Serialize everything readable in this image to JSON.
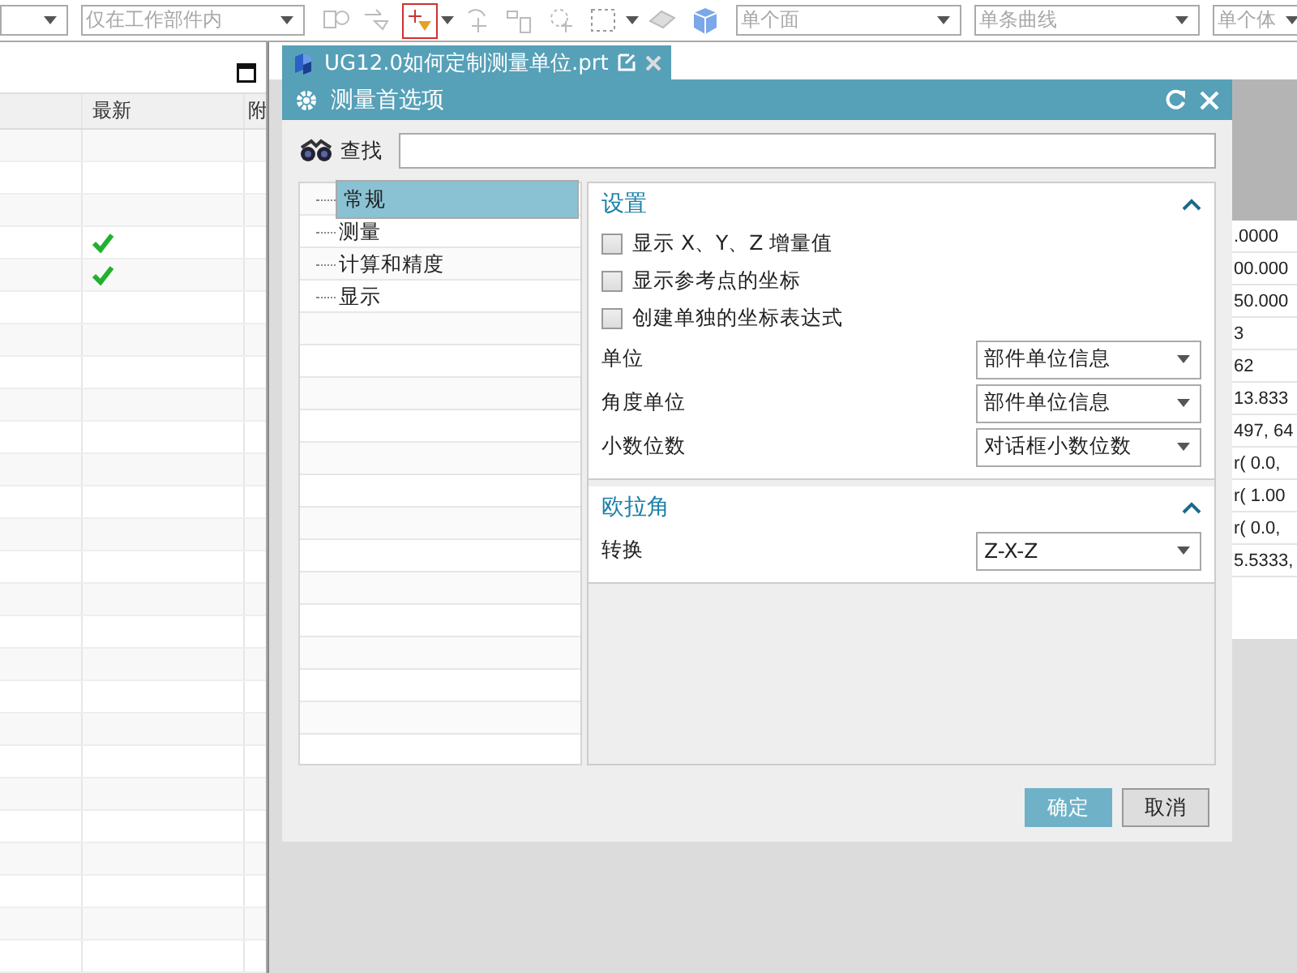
{
  "toolbar": {
    "filters": [
      {
        "value": "仅在工作部件内",
        "disabled": true
      },
      {
        "value": "单个面",
        "disabled": true
      },
      {
        "value": "单条曲线",
        "disabled": true
      },
      {
        "value": "单个体",
        "disabled": true
      }
    ],
    "tools": [
      {
        "selected": false,
        "dropdown": false
      },
      {
        "selected": false,
        "dropdown": false
      },
      {
        "selected": true,
        "dropdown": true
      },
      {
        "selected": false,
        "dropdown": false
      },
      {
        "selected": false,
        "dropdown": false
      },
      {
        "selected": false,
        "dropdown": false
      },
      {
        "selected": false,
        "dropdown": true
      },
      {
        "selected": false,
        "dropdown": false
      },
      {
        "selected": false,
        "dropdown": false
      }
    ]
  },
  "navigator": {
    "columns": [
      "最新",
      "附"
    ],
    "rows": [
      {
        "latest": false
      },
      {
        "latest": false
      },
      {
        "latest": false
      },
      {
        "latest": true
      },
      {
        "latest": true
      },
      {
        "latest": false
      },
      {
        "latest": false
      },
      {
        "latest": false
      },
      {
        "latest": false
      },
      {
        "latest": false
      },
      {
        "latest": false
      },
      {
        "latest": false
      },
      {
        "latest": false
      },
      {
        "latest": false
      },
      {
        "latest": false
      },
      {
        "latest": false
      },
      {
        "latest": false
      },
      {
        "latest": false
      },
      {
        "latest": false
      },
      {
        "latest": false
      },
      {
        "latest": false
      },
      {
        "latest": false
      },
      {
        "latest": false
      },
      {
        "latest": false
      },
      {
        "latest": false
      },
      {
        "latest": false
      }
    ]
  },
  "tab": {
    "title": "UG12.0如何定制测量单位.prt",
    "selected": true
  },
  "results": [
    ".0000",
    "00.000",
    "50.000",
    "3",
    "62",
    "13.833",
    "497, 64",
    "r( 0.0,",
    "r( 1.00",
    "r( 0.0,",
    "5.5333,"
  ],
  "dialog": {
    "title": "测量首选项",
    "search": {
      "label": "查找"
    },
    "tree": [
      {
        "label": "常规",
        "selected": true
      },
      {
        "label": "测量",
        "selected": false
      },
      {
        "label": "计算和精度",
        "selected": false
      },
      {
        "label": "显示",
        "selected": false
      }
    ],
    "groups": [
      {
        "title": "设置",
        "expanded": true,
        "checkboxes": [
          {
            "label": "显示 X、Y、Z 增量值",
            "checked": false
          },
          {
            "label": "显示参考点的坐标",
            "checked": false
          },
          {
            "label": "创建单独的坐标表达式",
            "checked": false
          }
        ],
        "fields": [
          {
            "label": "单位",
            "value": "部件单位信息"
          },
          {
            "label": "角度单位",
            "value": "部件单位信息"
          },
          {
            "label": "小数位数",
            "value": "对话框小数位数"
          }
        ]
      },
      {
        "title": "欧拉角",
        "expanded": true,
        "fields": [
          {
            "label": "转换",
            "value": "Z-X-Z"
          }
        ]
      }
    ],
    "buttons": [
      {
        "label": "确定",
        "kind": "primary"
      },
      {
        "label": "取消",
        "kind": "secondary"
      }
    ]
  }
}
